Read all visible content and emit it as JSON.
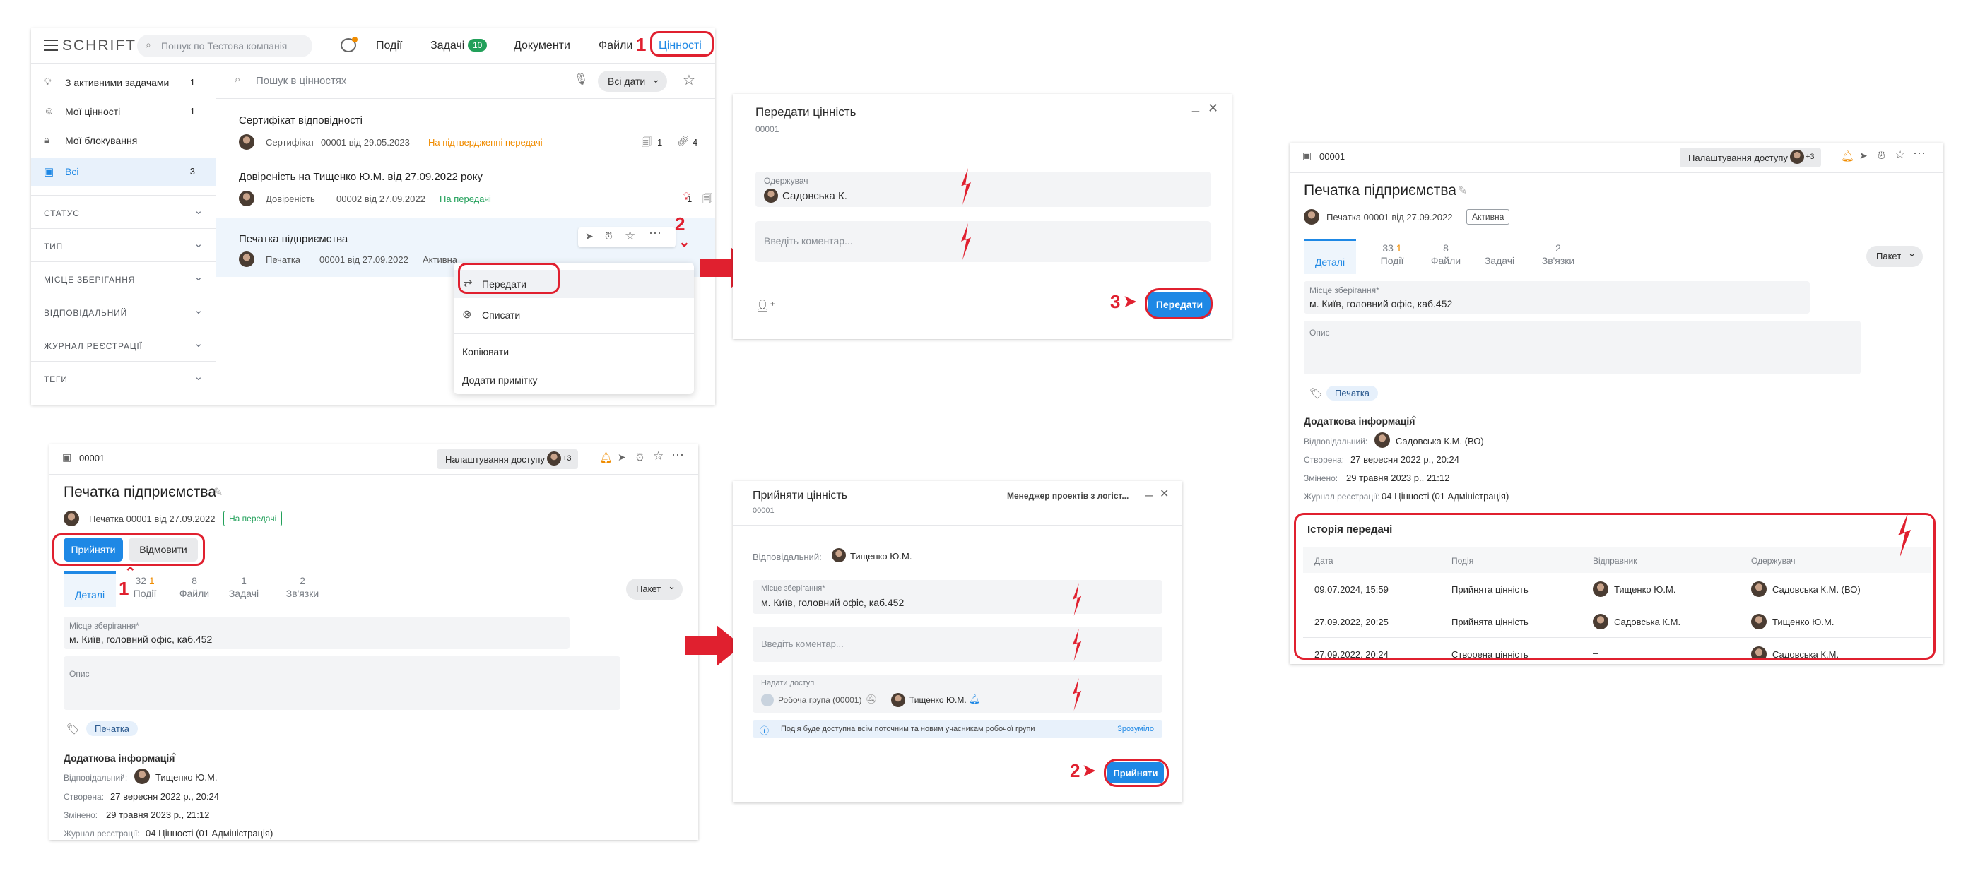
{
  "colors": {
    "accent": "#1e88e5",
    "highlight": "#e0202f",
    "warning": "#f08c00",
    "success": "#22a05a"
  },
  "steps": {
    "one": "1",
    "two": "2",
    "three": "3"
  },
  "p1": {
    "logo": "SCHRIFT",
    "search_placeholder": "Пошук по Тестова компанія",
    "nav": {
      "events": "Події",
      "tasks": "Задачі",
      "tasks_count": "10",
      "docs": "Документи",
      "files": "Файли",
      "values": "Цінності"
    },
    "sidebar": [
      {
        "label": "З активними задачами",
        "count": "1"
      },
      {
        "label": "Мої цінності",
        "count": "1"
      },
      {
        "label": "Мої блокування",
        "count": ""
      },
      {
        "label": "Всі",
        "count": "3"
      }
    ],
    "filters": [
      "СТАТУС",
      "ТИП",
      "МІСЦЕ ЗБЕРІГАННЯ",
      "ВІДПОВІДАЛЬНИЙ",
      "ЖУРНАЛ РЕЄСТРАЦІЇ",
      "ТЕГИ"
    ],
    "list_search_placeholder": "Пошук в цінностях",
    "date_filter": "Всі дати",
    "items": [
      {
        "title": "Сертифікат відповідності",
        "type": "Сертифікат",
        "ref": "00001 від 29.05.2023",
        "status": "На підтвердженні передачі",
        "docs": "1",
        "links": "4"
      },
      {
        "title": "Довіреність на Тищенко Ю.М. від 27.09.2022 року",
        "type": "Довіреність",
        "ref": "00002 від 27.09.2022",
        "status": "На передачі",
        "docs": "1"
      },
      {
        "title": "Печатка підприємства",
        "type": "Печатка",
        "ref": "00001 від 27.09.2022",
        "status": "Активна"
      }
    ],
    "menu": {
      "transfer": "Передати",
      "writeoff": "Списати",
      "copy": "Копіювати",
      "add_note": "Додати примітку"
    }
  },
  "p2": {
    "title": "Передати цінність",
    "code": "00001",
    "recipient_label": "Одержувач",
    "recipient_value": "Садовська К.",
    "comment_placeholder": "Введіть коментар...",
    "submit": "Передати"
  },
  "p3": {
    "code": "00001",
    "access_btn": "Налаштування доступу",
    "access_more": "+3",
    "title": "Печатка підприємства",
    "meta": "Печатка 00001 від 27.09.2022",
    "status": "Активна",
    "tabs": [
      {
        "label": "Деталі",
        "n": "",
        "n2": ""
      },
      {
        "label": "Події",
        "n": "33",
        "n2": "1"
      },
      {
        "label": "Файли",
        "n": "8",
        "n2": ""
      },
      {
        "label": "Задачі",
        "n": "",
        "n2": ""
      },
      {
        "label": "Зв'язки",
        "n": "2",
        "n2": ""
      }
    ],
    "package": "Пакет",
    "storage_label": "Місце зберігання*",
    "storage_value": "м. Київ, головний офіс, каб.452",
    "desc_label": "Опис",
    "tag": "Печатка",
    "addl_title": "Додаткова інформація",
    "resp_label": "Відповідальний:",
    "resp_value": "Садовська К.М. (ВО)",
    "created_label": "Створена:",
    "created_value": "27 вересня 2022 р., 20:24",
    "changed_label": "Змінено:",
    "changed_value": "29 травня 2023 р., 21:12",
    "journal_label": "Журнал реєстрації:",
    "journal_value": "04 Цінності (01 Адміністрація)",
    "history_title": "Історія передачі",
    "history_headers": [
      "Дата",
      "Подія",
      "Відправник",
      "Одержувач"
    ],
    "history_rows": [
      [
        "09.07.2024, 15:59",
        "Прийнята цінність",
        "Тищенко Ю.М.",
        "Садовська К.М. (ВО)"
      ],
      [
        "27.09.2022, 20:25",
        "Прийнята цінність",
        "Садовська К.М.",
        "Тищенко Ю.М."
      ],
      [
        "27.09.2022, 20:24",
        "Створена цінність",
        "–",
        "Садовська К.М."
      ]
    ]
  },
  "p4": {
    "code": "00001",
    "access_btn": "Налаштування доступу",
    "access_more": "+3",
    "title": "Печатка підприємства",
    "meta": "Печатка 00001 від 27.09.2022",
    "status": "На передачі",
    "accept": "Прийняти",
    "decline": "Відмовити",
    "tabs": [
      {
        "label": "Деталі",
        "n": "",
        "n2": ""
      },
      {
        "label": "Події",
        "n": "32",
        "n2": "1"
      },
      {
        "label": "Файли",
        "n": "8",
        "n2": ""
      },
      {
        "label": "Задачі",
        "n": "1",
        "n2": ""
      },
      {
        "label": "Зв'язки",
        "n": "2",
        "n2": ""
      }
    ],
    "package": "Пакет",
    "storage_label": "Місце зберігання*",
    "storage_value": "м. Київ, головний офіс, каб.452",
    "desc_label": "Опис",
    "tag": "Печатка",
    "addl_title": "Додаткова інформація",
    "resp_label": "Відповідальний:",
    "resp_value": "Тищенко Ю.М.",
    "created_label": "Створена:",
    "created_value": "27 вересня 2022 р., 20:24",
    "changed_label": "Змінено:",
    "changed_value": "29 травня 2023 р., 21:12",
    "journal_label": "Журнал реєстрації:",
    "journal_value": "04 Цінності (01 Адміністрація)"
  },
  "p5": {
    "title": "Прийняти цінність",
    "code": "00001",
    "role": "Менеджер проектів з логіст...",
    "resp_label": "Відповідальний:",
    "resp_value": "Тищенко Ю.М.",
    "storage_label": "Місце зберігання*",
    "storage_value": "м. Київ, головний офіс, каб.452",
    "comment_placeholder": "Введіть коментар...",
    "access_label": "Надати доступ",
    "group": "Робоча група (00001)",
    "person": "Тищенко Ю.М.",
    "info": "Подія буде доступна всім поточним та новим учасникам робочої групи",
    "info_ok": "Зрозуміло",
    "submit": "Прийняти"
  }
}
